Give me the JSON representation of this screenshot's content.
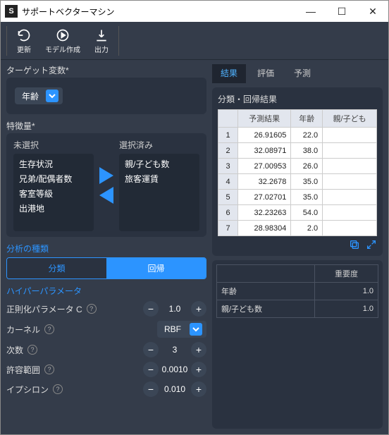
{
  "window": {
    "title": "サポートベクターマシン",
    "icon_letter": "S"
  },
  "toolbar": {
    "update": "更新",
    "create_model": "モデル作成",
    "output": "出力"
  },
  "left": {
    "target_var_label": "ターゲット変数*",
    "target_var_value": "年齢",
    "features_label": "特徴量*",
    "unselected_label": "未選択",
    "selected_label": "選択済み",
    "unselected_items": [
      "生存状況",
      "兄弟/配偶者数",
      "客室等級",
      "出港地"
    ],
    "selected_items": [
      "親/子ども数",
      "旅客運賃"
    ],
    "analysis_type_label": "分析の種類",
    "type_classification": "分類",
    "type_regression": "回帰",
    "hyperparam_label": "ハイパーパラメータ",
    "hp": {
      "reg_c_label": "正則化パラメータ C",
      "reg_c_value": "1.0",
      "kernel_label": "カーネル",
      "kernel_value": "RBF",
      "degree_label": "次数",
      "degree_value": "3",
      "tolerance_label": "許容範囲",
      "tolerance_value": "0.0010",
      "epsilon_label": "イプシロン",
      "epsilon_value": "0.010"
    }
  },
  "right": {
    "tabs": {
      "result": "結果",
      "eval": "評価",
      "predict": "予測"
    },
    "result_title": "分類・回帰結果",
    "table": {
      "headers": [
        "予測結果",
        "年齢",
        "親/子ども"
      ],
      "rows": [
        {
          "n": "1",
          "pred": "26.91605",
          "age": "22.0",
          "pc": ""
        },
        {
          "n": "2",
          "pred": "32.08971",
          "age": "38.0",
          "pc": ""
        },
        {
          "n": "3",
          "pred": "27.00953",
          "age": "26.0",
          "pc": ""
        },
        {
          "n": "4",
          "pred": "32.2678",
          "age": "35.0",
          "pc": ""
        },
        {
          "n": "5",
          "pred": "27.02701",
          "age": "35.0",
          "pc": ""
        },
        {
          "n": "6",
          "pred": "32.23263",
          "age": "54.0",
          "pc": ""
        },
        {
          "n": "7",
          "pred": "28.98304",
          "age": "2.0",
          "pc": ""
        }
      ]
    },
    "importance_header": "重要度",
    "importance_rows": [
      {
        "name": "年齢",
        "val": "1.0"
      },
      {
        "name": "親/子ども数",
        "val": "1.0"
      }
    ]
  }
}
